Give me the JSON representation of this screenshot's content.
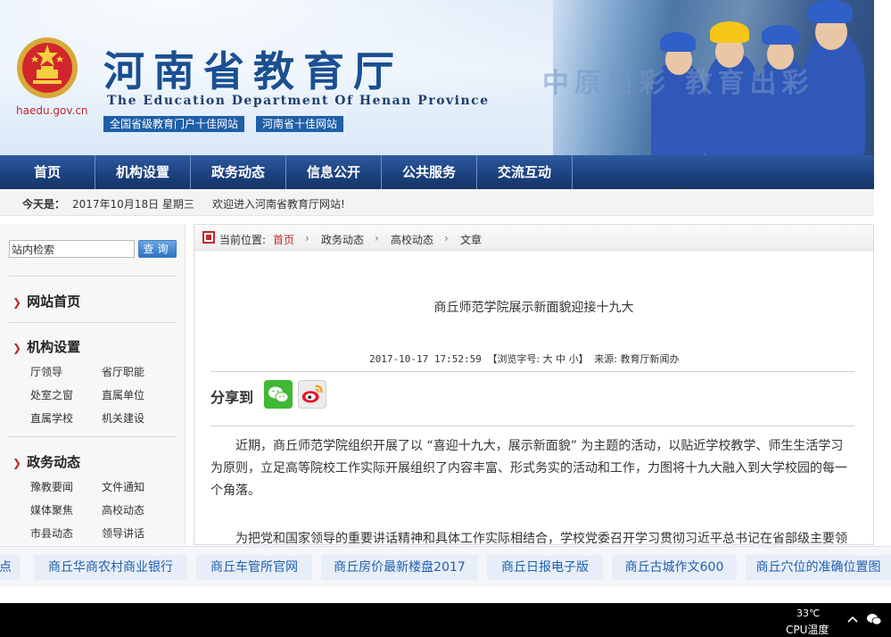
{
  "header": {
    "domain": "haedu.gov.cn",
    "title": "河南省教育厅",
    "title_en": "The Education Department Of Henan Province",
    "badges": [
      "全国省级教育门户十佳网站",
      "河南省十佳网站"
    ],
    "slogan": "中原出彩 教育出彩"
  },
  "nav": {
    "items": [
      "首页",
      "机构设置",
      "政务动态",
      "信息公开",
      "公共服务",
      "交流互动"
    ]
  },
  "datebar": {
    "label": "今天是：",
    "date": "2017年10月18日  星期三",
    "welcome": "欢迎进入河南省教育厅网站!"
  },
  "sidebar": {
    "search_value": "站内检索",
    "search_button": "查询",
    "home": "网站首页",
    "sections": [
      {
        "title": "机构设置",
        "links": [
          "厅领导",
          "省厅职能",
          "处室之窗",
          "直属单位",
          "直属学校",
          "机关建设"
        ]
      },
      {
        "title": "政务动态",
        "links": [
          "豫教要闻",
          "文件通知",
          "媒体聚焦",
          "高校动态",
          "市县动态",
          "领导讲话"
        ]
      }
    ]
  },
  "breadcrumb": {
    "label": "当前位置:",
    "items": [
      "首页",
      "政务动态",
      "高校动态",
      "文章"
    ],
    "separator": "›"
  },
  "article": {
    "title": "商丘师范学院展示新面貌迎接十九大",
    "datetime": "2017-10-17 17:52:59",
    "font_size_label": "【浏览字号: 大 中 小】",
    "source": "来源: 教育厅新闻办",
    "share_label": "分享到",
    "paragraphs": [
      "近期，商丘师范学院组织开展了以 “喜迎十九大，展示新面貌” 为主题的活动，以贴近学校教学、师生生活学习为原则，立足高等院校工作实际开展组织了内容丰富、形式务实的活动和工作，力图将十九大融入到大学校园的每一个角落。",
      "为把党和国家领导的重要讲话精神和具体工作实际相结合，学校党委召开学习贯彻习近平总书记在省部级主要领"
    ]
  },
  "ads": [
    "点",
    "商丘华商农村商业银行",
    "商丘车管所官网",
    "商丘房价最新楼盘2017",
    "商丘日报电子版",
    "商丘古城作文600",
    "商丘穴位的准确位置图"
  ],
  "taskbar": {
    "temp": "33℃",
    "cpu_label": "CPU温度"
  },
  "colors": {
    "nav": "#1d4280",
    "accent_red": "#c0282d",
    "badge": "#1f5fa7",
    "link_blue": "#1f5fb0"
  }
}
